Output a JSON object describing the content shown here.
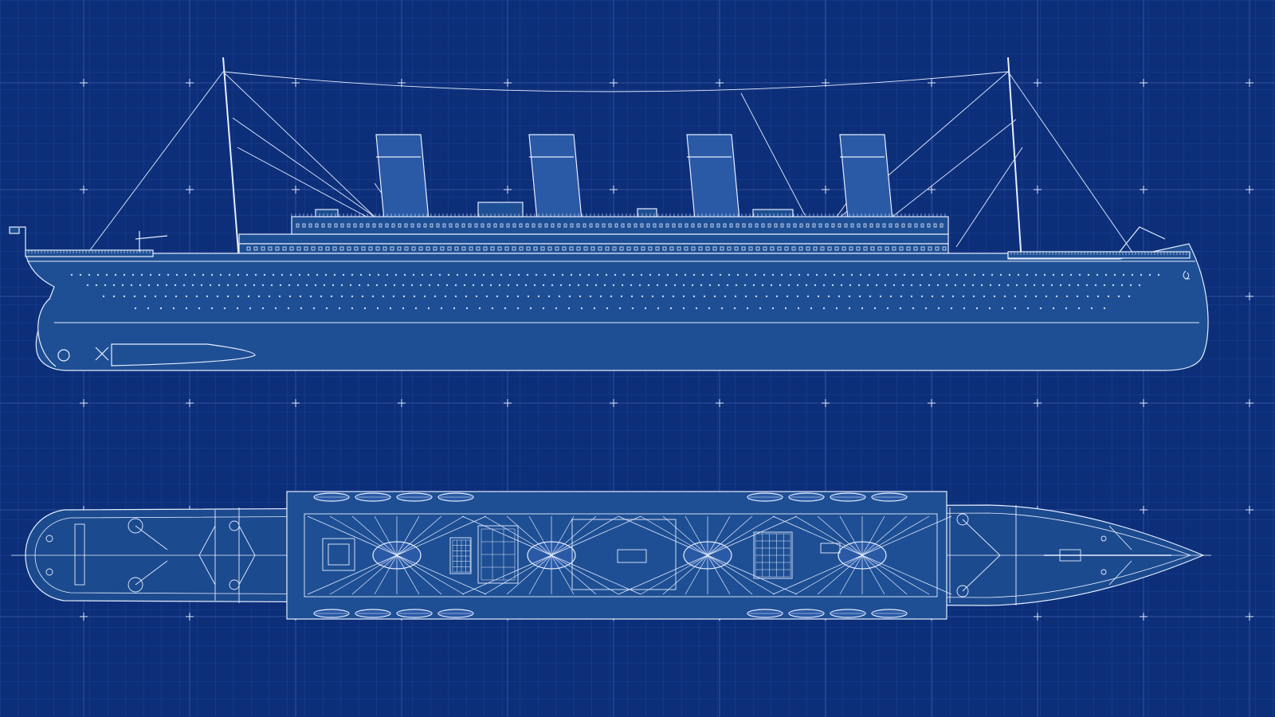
{
  "drawing": {
    "views": [
      "side-elevation",
      "plan-view"
    ],
    "funnel_count": 4,
    "mast_count": 2,
    "colors": {
      "background": "#0d2f7a",
      "grid_minor": "#1f479a",
      "grid_major": "#3f66b6",
      "line": "#e6eeff",
      "hull_fill": "#1e4f94",
      "funnel_fill": "#2a5aa6"
    }
  }
}
